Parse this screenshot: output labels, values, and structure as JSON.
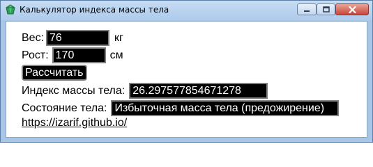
{
  "window": {
    "title": "Калькулятор индекса массы тела",
    "icon": "green-gem-icon",
    "controls": [
      "minimize",
      "maximize",
      "close"
    ]
  },
  "form": {
    "weight_label": "Вес:",
    "weight_value": "76",
    "weight_unit": "кг",
    "height_label": "Рост:",
    "height_value": "170",
    "height_unit": "см",
    "calculate_label": "Рассчитать",
    "bmi_label": "Индекс массы тела:",
    "bmi_value": "26.297577854671278",
    "state_label": "Состояние тела:",
    "state_value": "Избыточная масса тела (предожирение)",
    "link_text": "https://izarif.github.io/"
  },
  "colors": {
    "field_bg": "#000000",
    "field_text": "#ffffff",
    "field_border": "#808080",
    "close_button": "#c7453a"
  }
}
